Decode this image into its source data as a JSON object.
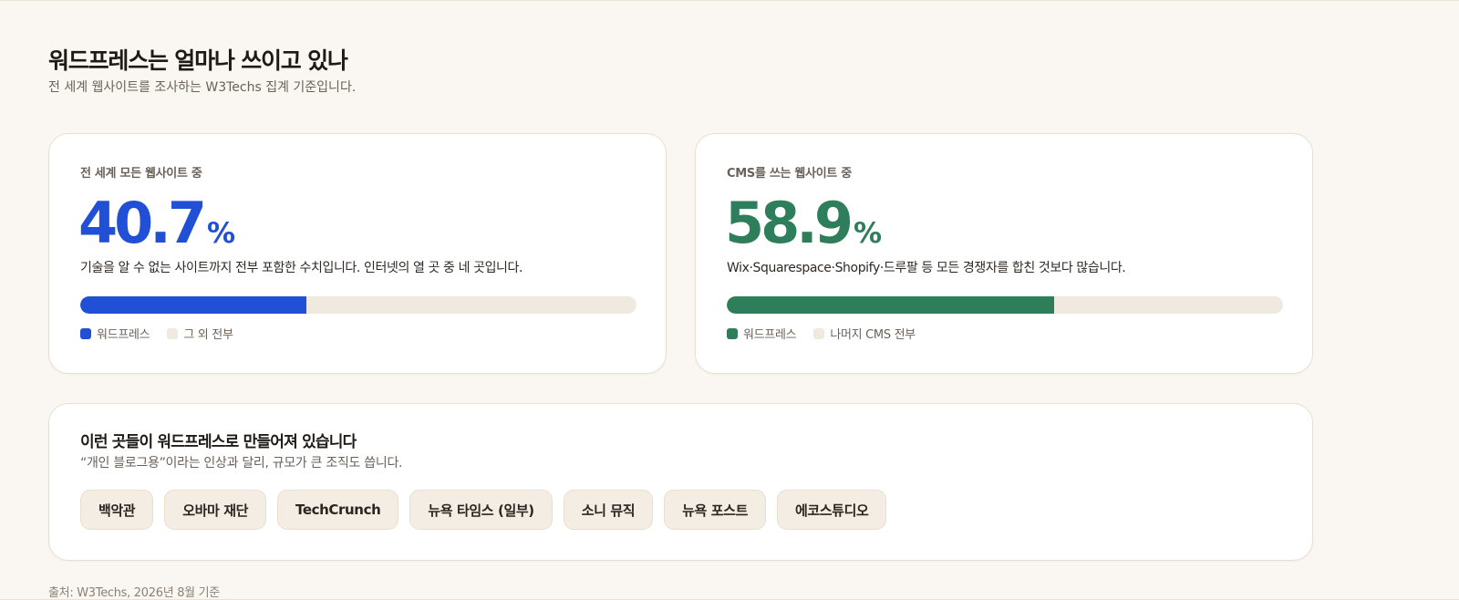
{
  "header": {
    "title": "워드프레스는 얼마나 쓰이고 있나",
    "subtitle": "전 세계 웹사이트를 조사하는 W3Techs 집계 기준입니다."
  },
  "cards": [
    {
      "label": "전 세계 모든 웹사이트 중",
      "value": "40.7",
      "unit": "%",
      "share": 0.407,
      "color": "#2150d6",
      "description": "기술을 알 수 없는 사이트까지 전부 포함한 수치입니다. 인터넷의 열 곳 중 네 곳입니다.",
      "legend": [
        "워드프레스",
        "그 외 전부"
      ]
    },
    {
      "label": "CMS를 쓰는 웹사이트 중",
      "value": "58.9",
      "unit": "%",
      "share": 0.589,
      "color": "#2e7d5b",
      "description": "Wix·Squarespace·Shopify·드루팔 등 모든 경쟁자를 합친 것보다 많습니다.",
      "legend": [
        "워드프레스",
        "나머지 CMS 전부"
      ]
    }
  ],
  "sites": {
    "title": "이런 곳들이 워드프레스로 만들어져 있습니다",
    "subtitle": "“개인 블로그용”이라는 인상과 달리, 규모가 큰 조직도 씁니다.",
    "chips": [
      "백악관",
      "오바마 재단",
      "TechCrunch",
      "뉴욕 타임스 (일부)",
      "소니 뮤직",
      "뉴욕 포스트",
      "에코스튜디오"
    ]
  },
  "footer": {
    "source": "출처: W3Techs, 2026년 8월 기준"
  },
  "colors": {
    "background": "#faf7f2",
    "rest": "#efe9df"
  }
}
